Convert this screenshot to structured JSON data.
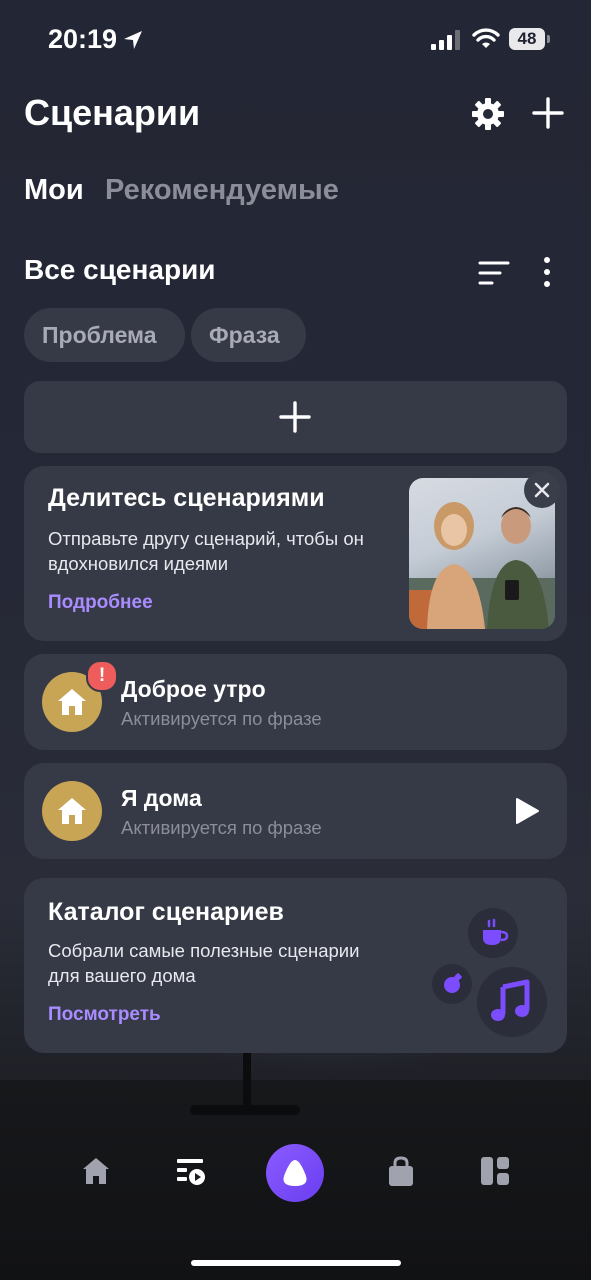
{
  "status_bar": {
    "time": "20:19",
    "battery": "48"
  },
  "header": {
    "title": "Сценарии",
    "icons": [
      "gear-icon",
      "plus-icon"
    ]
  },
  "tabs": [
    {
      "label": "Мои",
      "active": true
    },
    {
      "label": "Рекомендуемые",
      "active": false
    }
  ],
  "section": {
    "title": "Все сценарии",
    "icons": [
      "sort-icon",
      "more-icon"
    ]
  },
  "filters": [
    "Проблема",
    "Фраза"
  ],
  "share_card": {
    "title": "Делитесь сценариями",
    "description": "Отправьте другу сценарий, чтобы он вдохновился идеями",
    "link": "Подробнее"
  },
  "scenarios": [
    {
      "title": "Доброе утро",
      "subtitle": "Активируется по фразе",
      "badge": "!",
      "icon": "house-icon"
    },
    {
      "title": "Я дома",
      "subtitle": "Активируется по фразе",
      "icon": "house-icon",
      "action_icon": "play-icon"
    }
  ],
  "catalog": {
    "title": "Каталог сценариев",
    "description": "Собрали самые полезные сценарии для вашего дома",
    "link": "Посмотреть",
    "icons": [
      "coffee-icon",
      "bulb-icon",
      "music-icon"
    ]
  },
  "bottom_nav": [
    "home-icon",
    "scenarios-icon",
    "alice-icon",
    "shop-icon",
    "widgets-icon"
  ],
  "colors": {
    "accent": "#a98cff",
    "card": "#363946",
    "avatar": "#c8a455",
    "badge": "#ef5c5c",
    "alice": "#7b4dff"
  }
}
